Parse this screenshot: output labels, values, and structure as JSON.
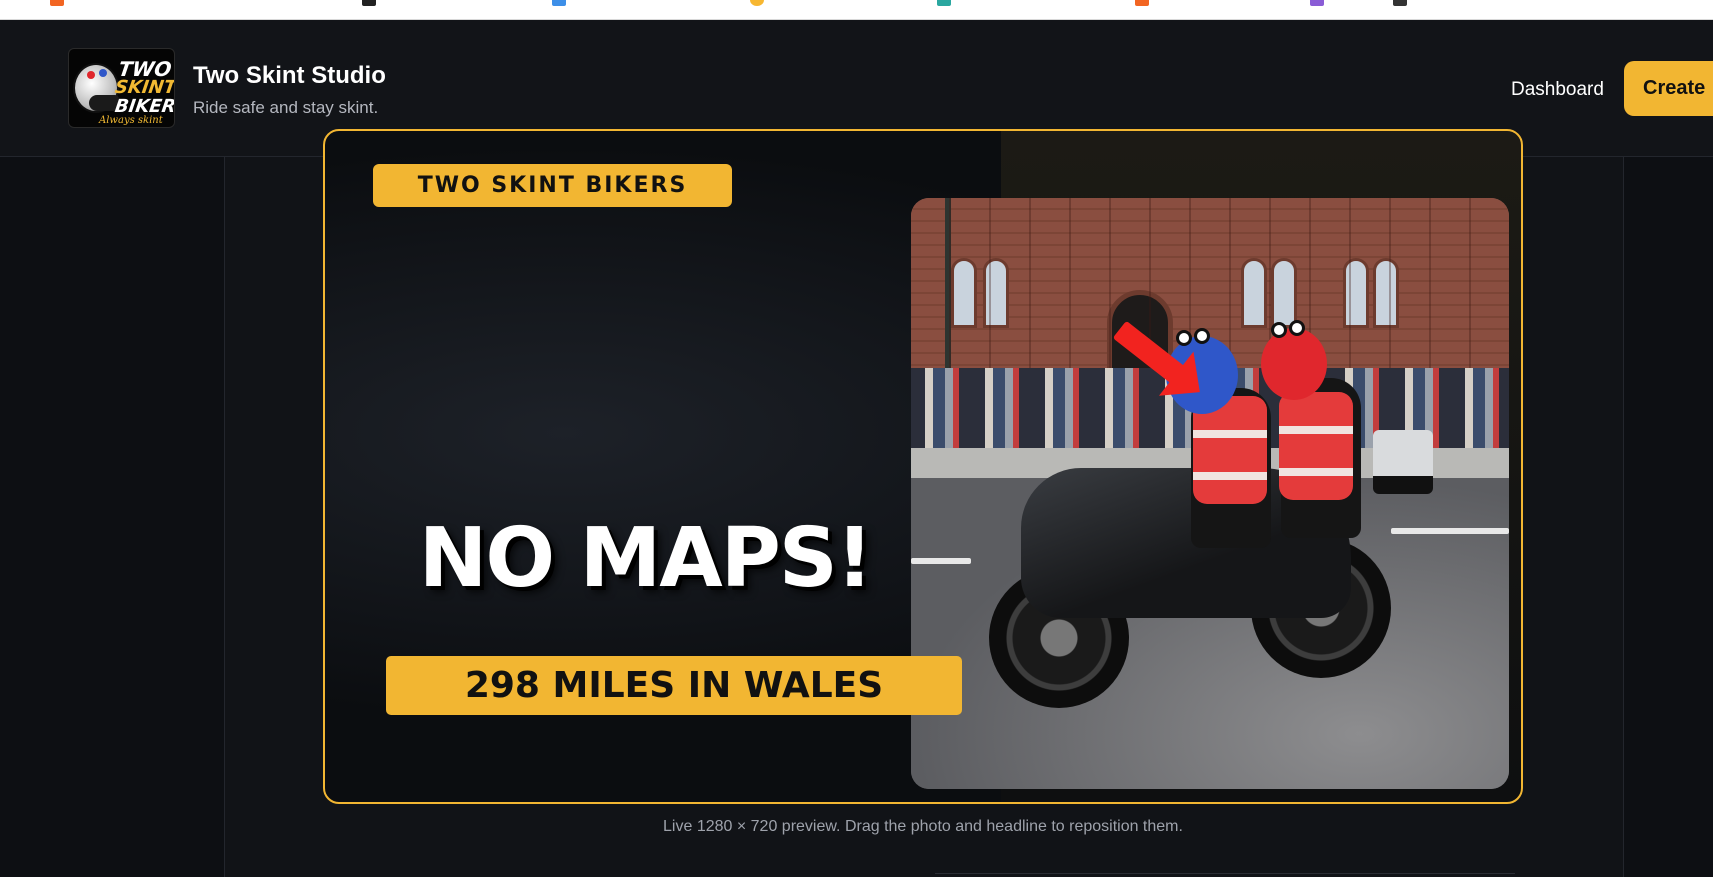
{
  "header": {
    "brand_title": "Two Skint Studio",
    "brand_tagline": "Ride safe and stay skint.",
    "logo_text": [
      "TWO",
      "SKINT",
      "BIKERS",
      "Always skint"
    ],
    "nav": {
      "dashboard_label": "Dashboard",
      "create_label": "Create"
    }
  },
  "canvas": {
    "channel_badge": "TWO SKINT BIKERS",
    "headline": "NO MAPS!",
    "subtitle": "298 MILES IN WALES",
    "preview_caption": "Live 1280 × 720 preview. Drag the photo and headline to reposition them."
  },
  "colors": {
    "accent": "#f2b632",
    "background": "#0d0f13",
    "header": "#121418",
    "arrow": "#f2231f"
  }
}
